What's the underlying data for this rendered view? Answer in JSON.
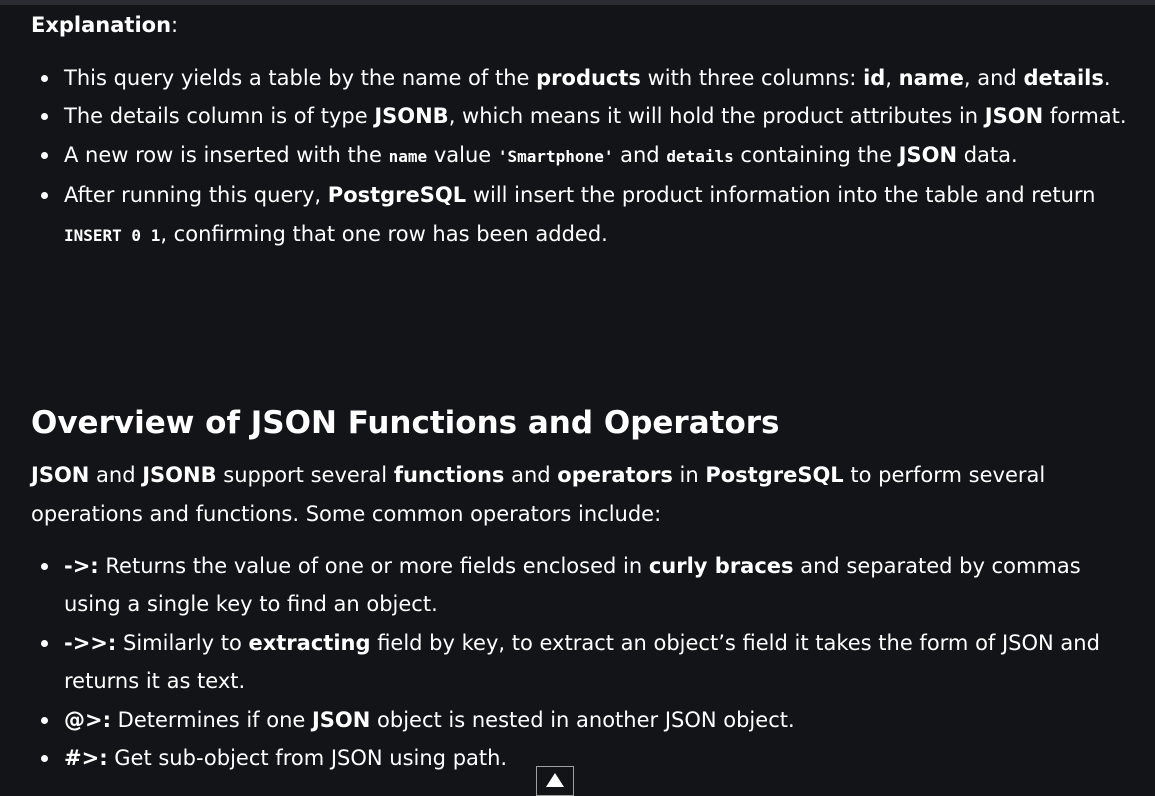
{
  "explanation": {
    "label": "Explanation",
    "colon": ":",
    "items": [
      {
        "t1": "This query yields a table by the name of the ",
        "b1": "products",
        "t2": " with three columns: ",
        "b2": "id",
        "t3": ", ",
        "b3": "name",
        "t4": ", and ",
        "b4": "details",
        "t5": "."
      },
      {
        "t1": "The details column is of type ",
        "b1": "JSONB",
        "t2": ", which means it will hold the product attributes in ",
        "b2": "JSON",
        "t3": " format."
      },
      {
        "t1": "A new row is inserted with the ",
        "c1": "name",
        "t2": " value ",
        "c2": "'Smartphone'",
        "t3": " and ",
        "c3": "details",
        "t4": " containing the ",
        "b1": "JSON",
        "t5": " data."
      },
      {
        "t1": "After running this query, ",
        "b1": "PostgreSQL",
        "t2": " will insert the product information into the table and return ",
        "c1": "INSERT 0 1",
        "t3": ", confirming that one row has been added."
      }
    ]
  },
  "overview": {
    "heading": "Overview of JSON Functions and Operators",
    "para": {
      "b1": "JSON",
      "t1": " and ",
      "b2": "JSONB",
      "t2": " support several ",
      "b3": "functions",
      "t3": " and ",
      "b4": "operators",
      "t4": " in ",
      "b5": "PostgreSQL",
      "t5": " to perform several operations and functions. Some common operators include:"
    },
    "operators": [
      {
        "op": "->:",
        "t1": " Returns the value of one or more fields enclosed in ",
        "b1": "curly braces",
        "t2": " and separated by commas using a single key to find an object."
      },
      {
        "op": "->>:",
        "t1": " Similarly to ",
        "b1": "extracting",
        "t2": " field by key, to extract an object’s field it takes the form of JSON and returns it as text."
      },
      {
        "op": "@>:",
        "t1": " Determines if one ",
        "b1": "JSON",
        "t2": " object is nested in another JSON object."
      },
      {
        "op": "#>:",
        "t1": " Get sub-object from JSON using path."
      }
    ]
  },
  "scroll_top": {
    "icon": "arrow-up-icon"
  }
}
